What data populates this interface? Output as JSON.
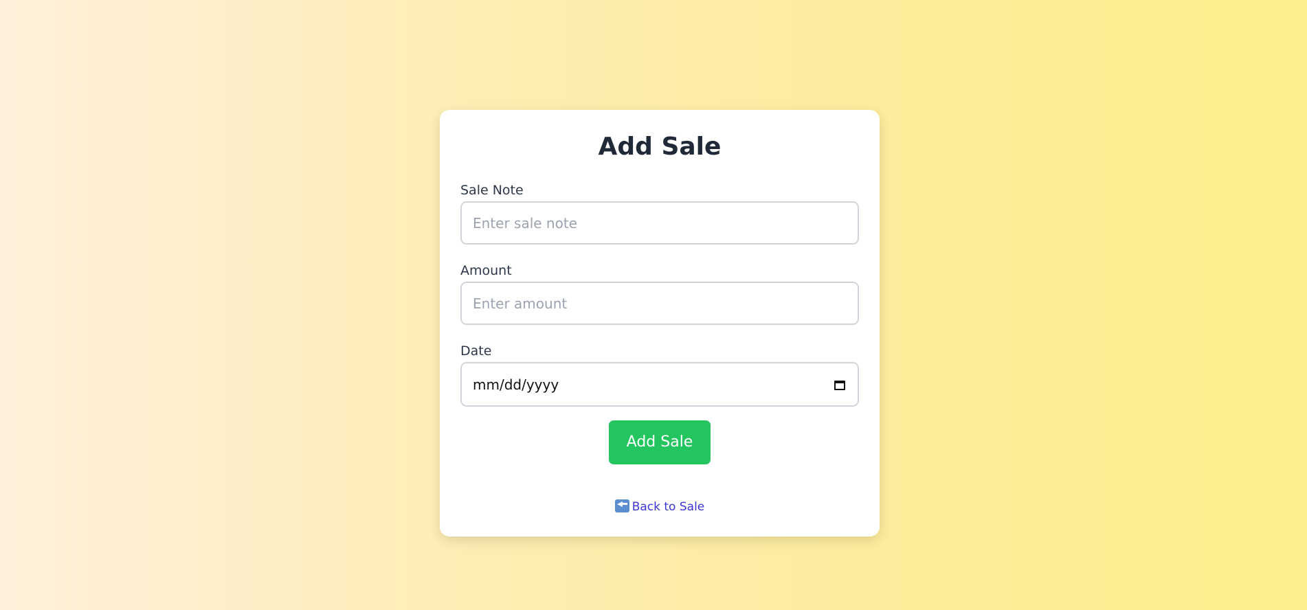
{
  "form": {
    "title": "Add Sale",
    "fields": [
      {
        "label": "Sale Note",
        "placeholder": "Enter sale note",
        "value": ""
      },
      {
        "label": "Amount",
        "placeholder": "Enter amount",
        "value": ""
      },
      {
        "label": "Date",
        "placeholder": "mm/dd/yyyy",
        "value": ""
      }
    ],
    "submit_label": "Add Sale",
    "back_link_label": "Back to Sale",
    "back_icon": "back-arrow-icon"
  },
  "colors": {
    "primary_button": "#22c55e",
    "link": "#3b35d8",
    "heading": "#1f2937"
  }
}
